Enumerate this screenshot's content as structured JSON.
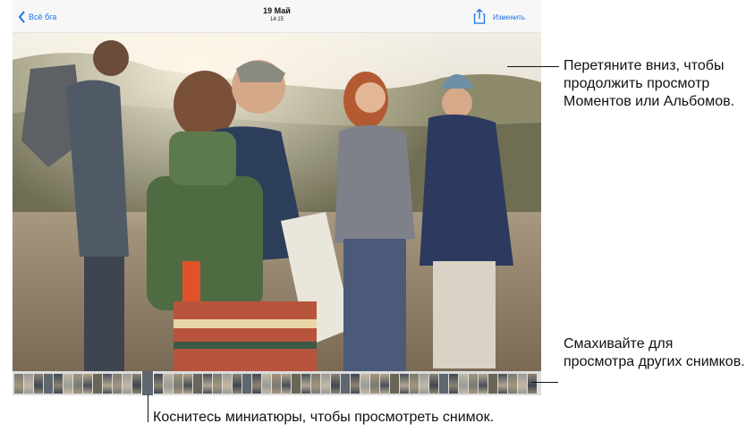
{
  "navbar": {
    "back_label": "Всё бга",
    "date": "19 Май",
    "time": "14:15",
    "edit_label": "Изменить"
  },
  "icons": {
    "back": "chevron-left-icon",
    "share": "share-icon"
  },
  "colors": {
    "accent": "#1a73e8",
    "caption": "#111111"
  },
  "captions": {
    "swipe_down": "Перетяните вниз, чтобы продолжить просмотр Моментов или Альбомов.",
    "swipe_strip": "Смахивайте для просмотра других снимков.",
    "tap_thumb": "Коснитесь миниатюры, чтобы просмотреть снимок."
  }
}
